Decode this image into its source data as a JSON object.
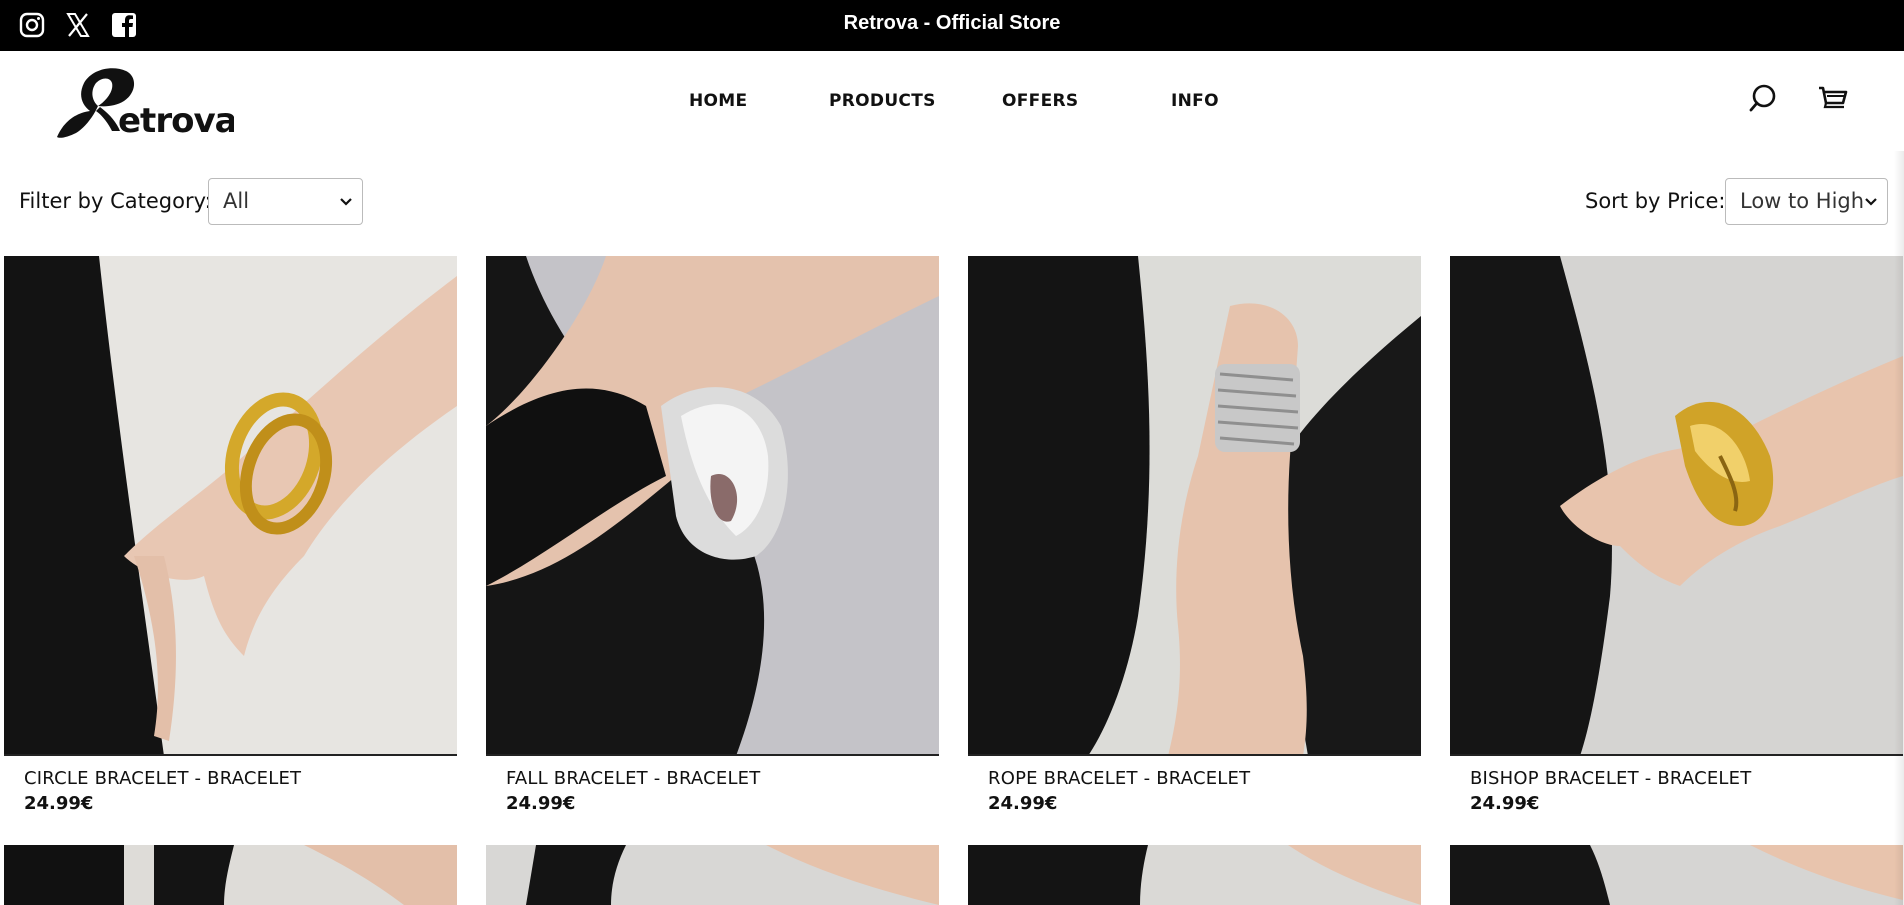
{
  "topbar": {
    "title": "Retrova - Official Store",
    "social_icons": [
      "instagram-icon",
      "x-icon",
      "facebook-icon"
    ]
  },
  "header": {
    "logo_text": "Retrova",
    "nav": [
      {
        "label": "HOME"
      },
      {
        "label": "PRODUCTS"
      },
      {
        "label": "OFFERS"
      },
      {
        "label": "INFO"
      }
    ],
    "icons": [
      "search-icon",
      "cart-icon"
    ]
  },
  "filters": {
    "category_label": "Filter by Category:",
    "category_value": "All",
    "sort_label": "Sort by Price:",
    "sort_value": "Low to High"
  },
  "products": [
    {
      "name": "CIRCLE BRACELET - BRACELET",
      "price": "24.99€",
      "metal": "gold"
    },
    {
      "name": "FALL BRACELET - BRACELET",
      "price": "24.99€",
      "metal": "silver"
    },
    {
      "name": "ROPE BRACELET - BRACELET",
      "price": "24.99€",
      "metal": "silver"
    },
    {
      "name": "BISHOP BRACELET - BRACELET",
      "price": "24.99€",
      "metal": "gold"
    }
  ],
  "colors": {
    "topbar_bg": "#000000",
    "accent_gold": "#d4a82a",
    "accent_silver": "#cfcfd4"
  }
}
